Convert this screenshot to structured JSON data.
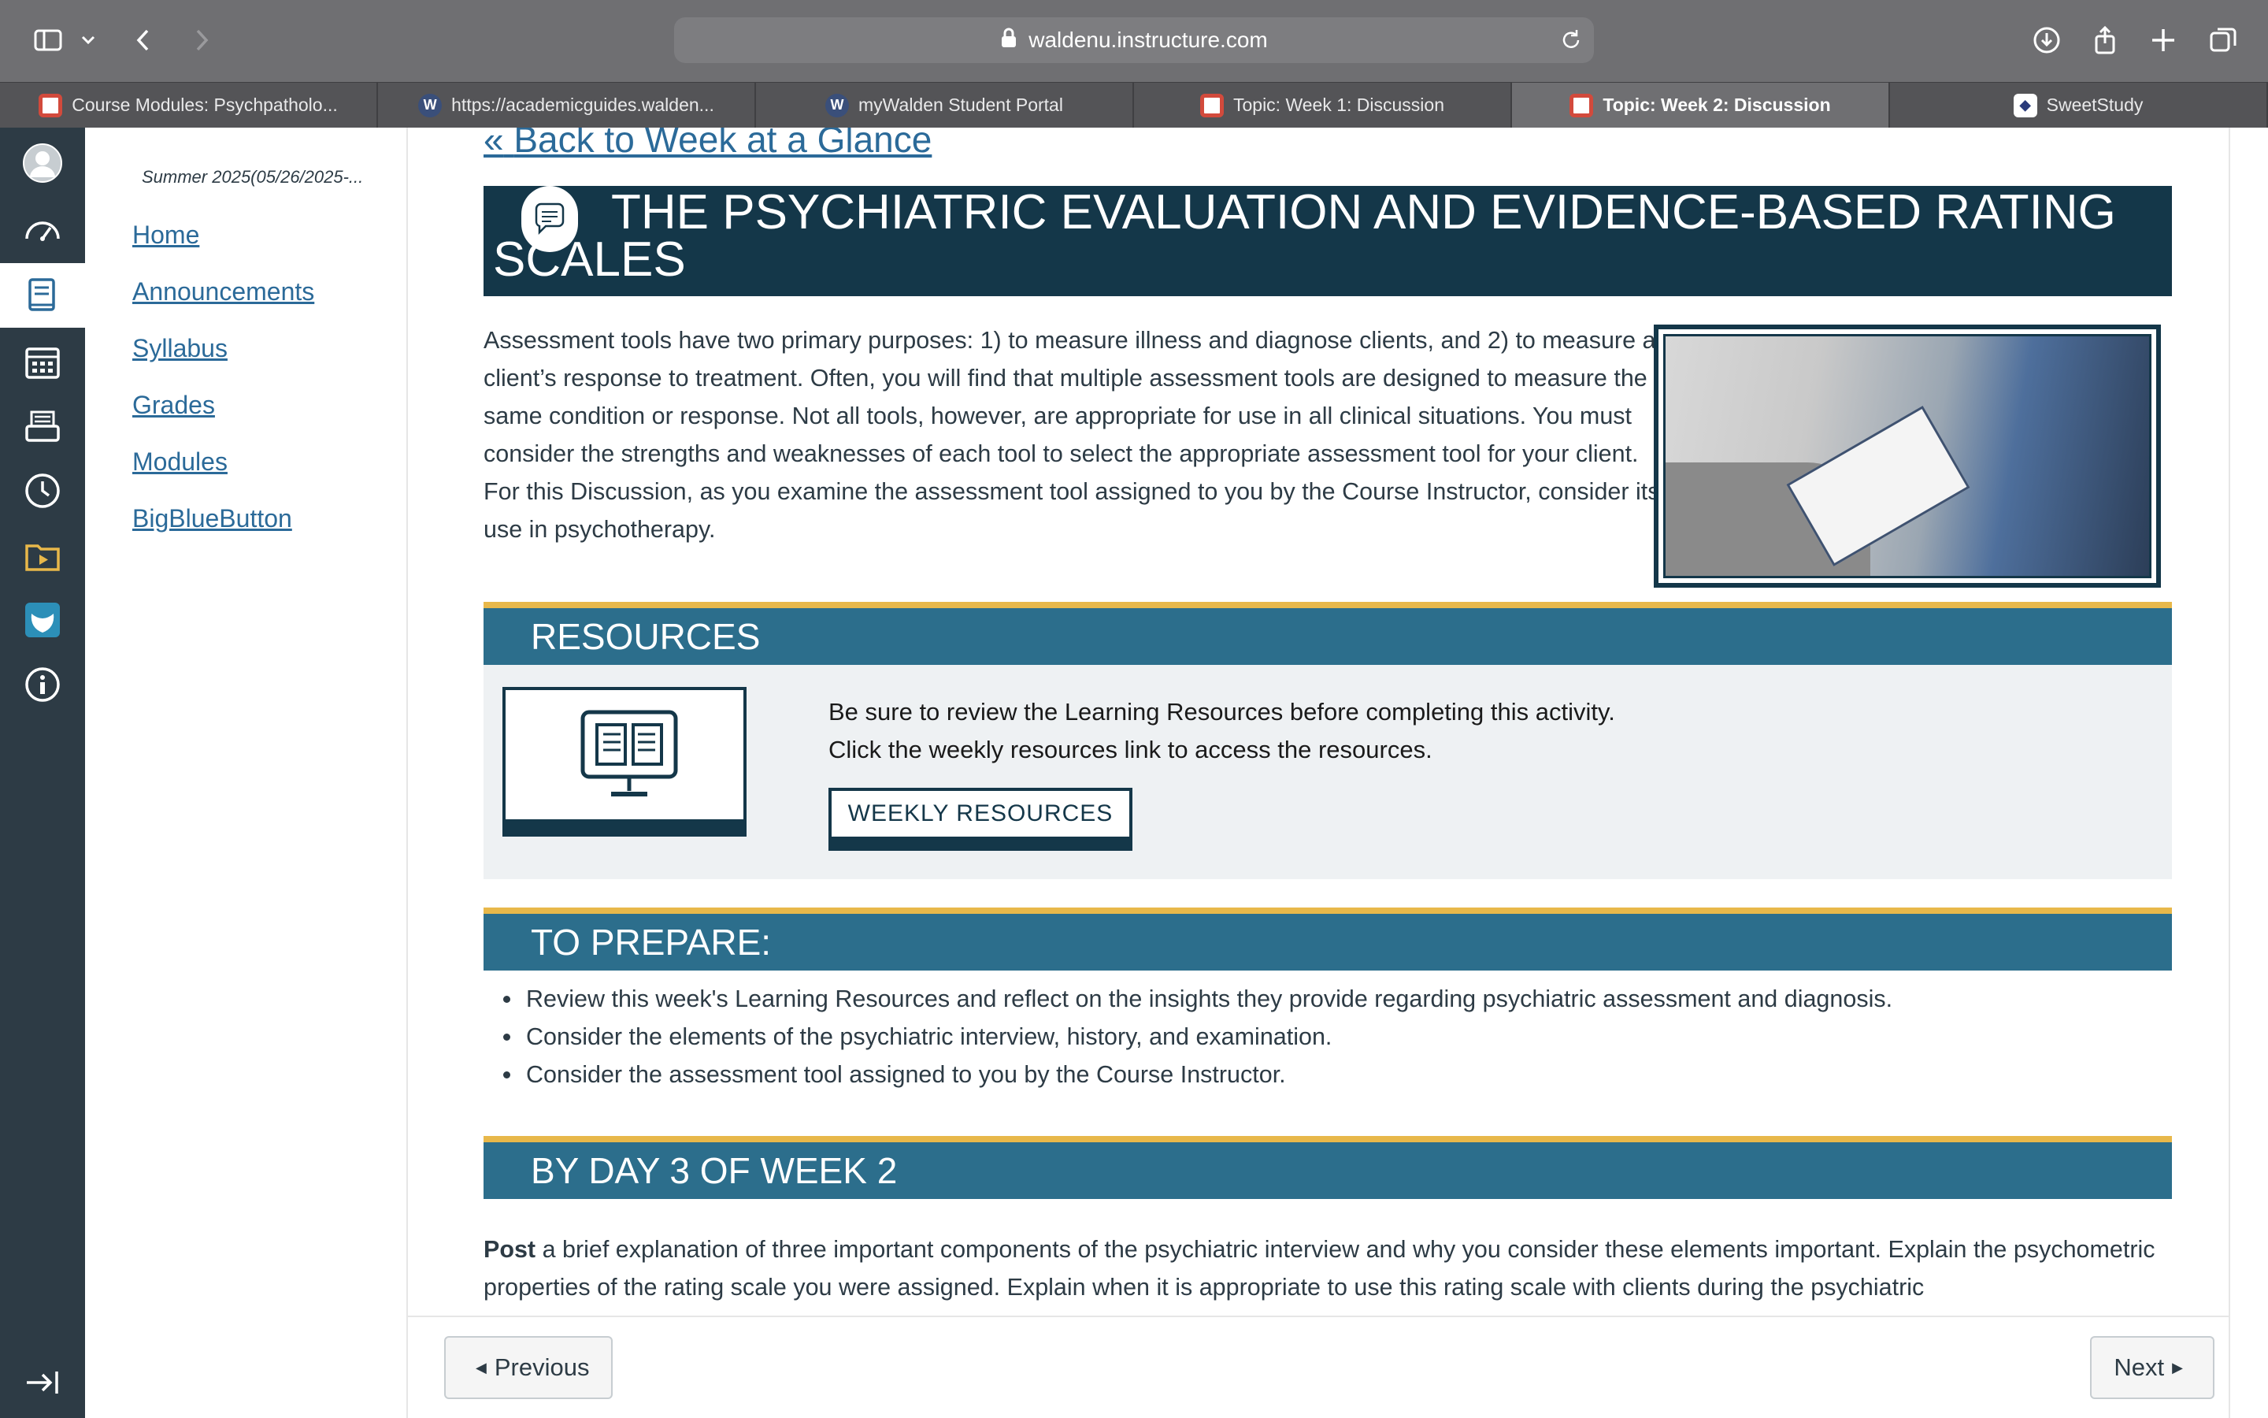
{
  "browser": {
    "url": "waldenu.instructure.com",
    "tabs": [
      {
        "label": "Course Modules: Psychpatholo...",
        "icon": "canvas-icon",
        "active": false
      },
      {
        "label": "https://academicguides.walden...",
        "icon": "wordpress-icon",
        "active": false
      },
      {
        "label": "myWalden Student Portal",
        "icon": "wordpress-icon",
        "active": false
      },
      {
        "label": "Topic: Week 1: Discussion",
        "icon": "canvas-icon",
        "active": false
      },
      {
        "label": "Topic: Week 2: Discussion",
        "icon": "canvas-icon",
        "active": true
      },
      {
        "label": "SweetStudy",
        "icon": "sweetstudy-icon",
        "active": false
      }
    ]
  },
  "global_nav": {
    "items": [
      "account-icon",
      "dashboard-icon",
      "courses-icon",
      "calendar-icon",
      "inbox-icon",
      "history-icon",
      "studio-icon",
      "walden-owl-icon",
      "help-icon",
      "collapse-icon"
    ],
    "active": "courses-icon"
  },
  "course_nav": {
    "term": "Summer 2025(05/26/2025-...",
    "links": [
      "Home",
      "Announcements",
      "Syllabus",
      "Grades",
      "Modules",
      "BigBlueButton"
    ]
  },
  "content": {
    "back_link": "Back to Week at a Glance",
    "banner_title": "THE PSYCHIATRIC EVALUATION AND EVIDENCE-BASED RATING SCALES",
    "intro": "Assessment tools have two primary purposes: 1) to measure illness and diagnose clients, and 2) to measure a client’s response to treatment. Often, you will find that multiple assessment tools are designed to measure the same condition or response. Not all tools, however, are appropriate for use in all clinical situations. You must consider the strengths and weaknesses of each tool to select the appropriate assessment tool for your client. For this Discussion, as you examine the assessment tool assigned to you by the Course Instructor, consider its use in psychotherapy.",
    "resources": {
      "heading": "RESOURCES",
      "line1": "Be sure to review the Learning Resources before completing this activity.",
      "line2": "Click the weekly resources link to access the resources.",
      "button": "WEEKLY RESOURCES"
    },
    "prepare": {
      "heading": "TO PREPARE:",
      "items": [
        "Review this week's Learning Resources and reflect on the insights they provide regarding psychiatric assessment and diagnosis.",
        "Consider the elements of the psychiatric interview, history, and examination.",
        "Consider the assessment tool assigned to you by the Course Instructor."
      ]
    },
    "day3": {
      "heading": "BY DAY 3 OF WEEK 2",
      "post_bold": "Post",
      "post_text": " a brief explanation of three important components of the psychiatric interview and why you consider these elements important. Explain the psychometric properties of the rating scale you were assigned. Explain when it is appropriate to use this rating scale with clients during the psychiatric"
    }
  },
  "footer": {
    "previous": "Previous",
    "next": "Next"
  },
  "colors": {
    "banner": "#143749",
    "section": "#2c6e8c",
    "accent": "#e8b84a",
    "link": "#2b6a99",
    "global_nav": "#2d3b45"
  }
}
